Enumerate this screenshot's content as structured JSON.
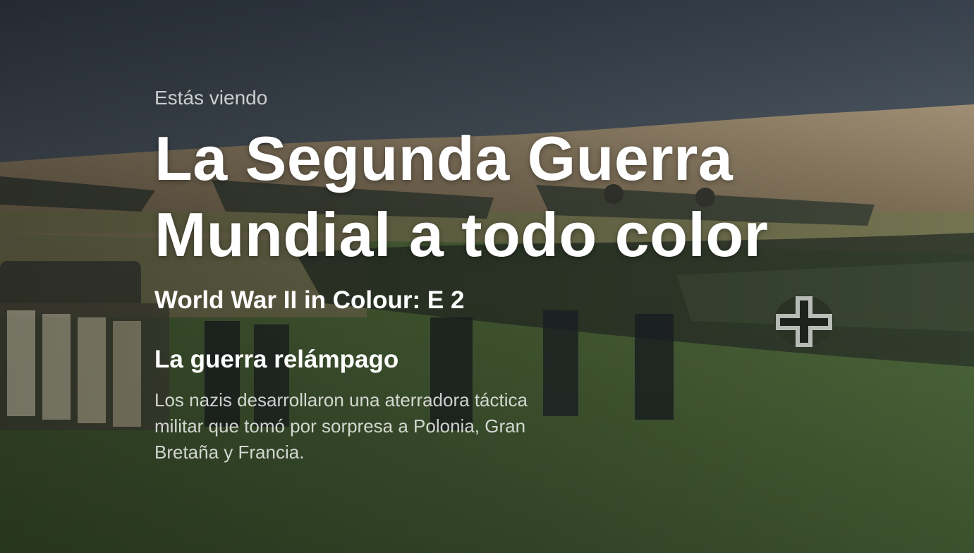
{
  "now_playing": {
    "eyebrow": "Estás viendo",
    "title": "La Segunda Guerra Mundial a todo color",
    "subtitle": "World War II in Colour: E 2",
    "episode_title": "La guerra relámpago",
    "synopsis": "Los nazis desarrollaron una aterradora táctica militar que tomó por sorpresa a Polonia, Gran Bretaña y Francia."
  },
  "colors": {
    "sky": "#3f4a55",
    "hills": "#9a8a6a",
    "grass": "#4f6b3a",
    "text": "#ffffff",
    "text_muted": "#cfcfcf"
  }
}
